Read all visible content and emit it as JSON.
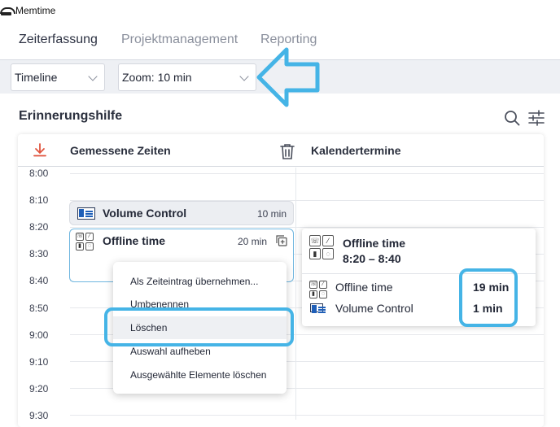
{
  "window": {
    "title": "Memtime"
  },
  "main_tabs": [
    {
      "label": "Zeiterfassung",
      "active": true
    },
    {
      "label": "Projektmanagement",
      "active": false
    },
    {
      "label": "Reporting",
      "active": false
    }
  ],
  "toolbar": {
    "view_select": {
      "value": "Timeline"
    },
    "zoom_select": {
      "value": "Zoom: 10 min"
    }
  },
  "section": {
    "title": "Erinnerungshilfe",
    "columns": {
      "measured": "Gemessene Zeiten",
      "calendar": "Kalendertermine"
    }
  },
  "timeline": {
    "times": [
      "8:00",
      "8:10",
      "8:20",
      "8:30",
      "8:40",
      "8:50",
      "9:00",
      "9:10",
      "9:20",
      "9:30"
    ]
  },
  "events": [
    {
      "title": "Volume Control",
      "duration": "10 min",
      "app": "volume-control"
    },
    {
      "title": "Offline time",
      "duration": "20 min",
      "app": "offline-time",
      "selected": true
    }
  ],
  "popover": {
    "title": "Offline time",
    "time_range": "8:20 – 8:40",
    "rows": [
      {
        "label": "Offline time",
        "value": "19 min"
      },
      {
        "label": "Volume Control",
        "value": "1 min"
      }
    ]
  },
  "context_menu": {
    "items": [
      {
        "label": "Als Zeiteintrag übernehmen..."
      },
      {
        "label": "Umbenennen"
      },
      {
        "label": "Löschen",
        "hover": true
      },
      {
        "label": "Auswahl aufheben"
      },
      {
        "label": "Ausgewählte Elemente löschen"
      }
    ]
  },
  "colors": {
    "accent": "#45b4e6",
    "selected_border": "#6fb6df",
    "download_icon": "#e0533d",
    "toolbar_bg": "#eef0f4"
  }
}
